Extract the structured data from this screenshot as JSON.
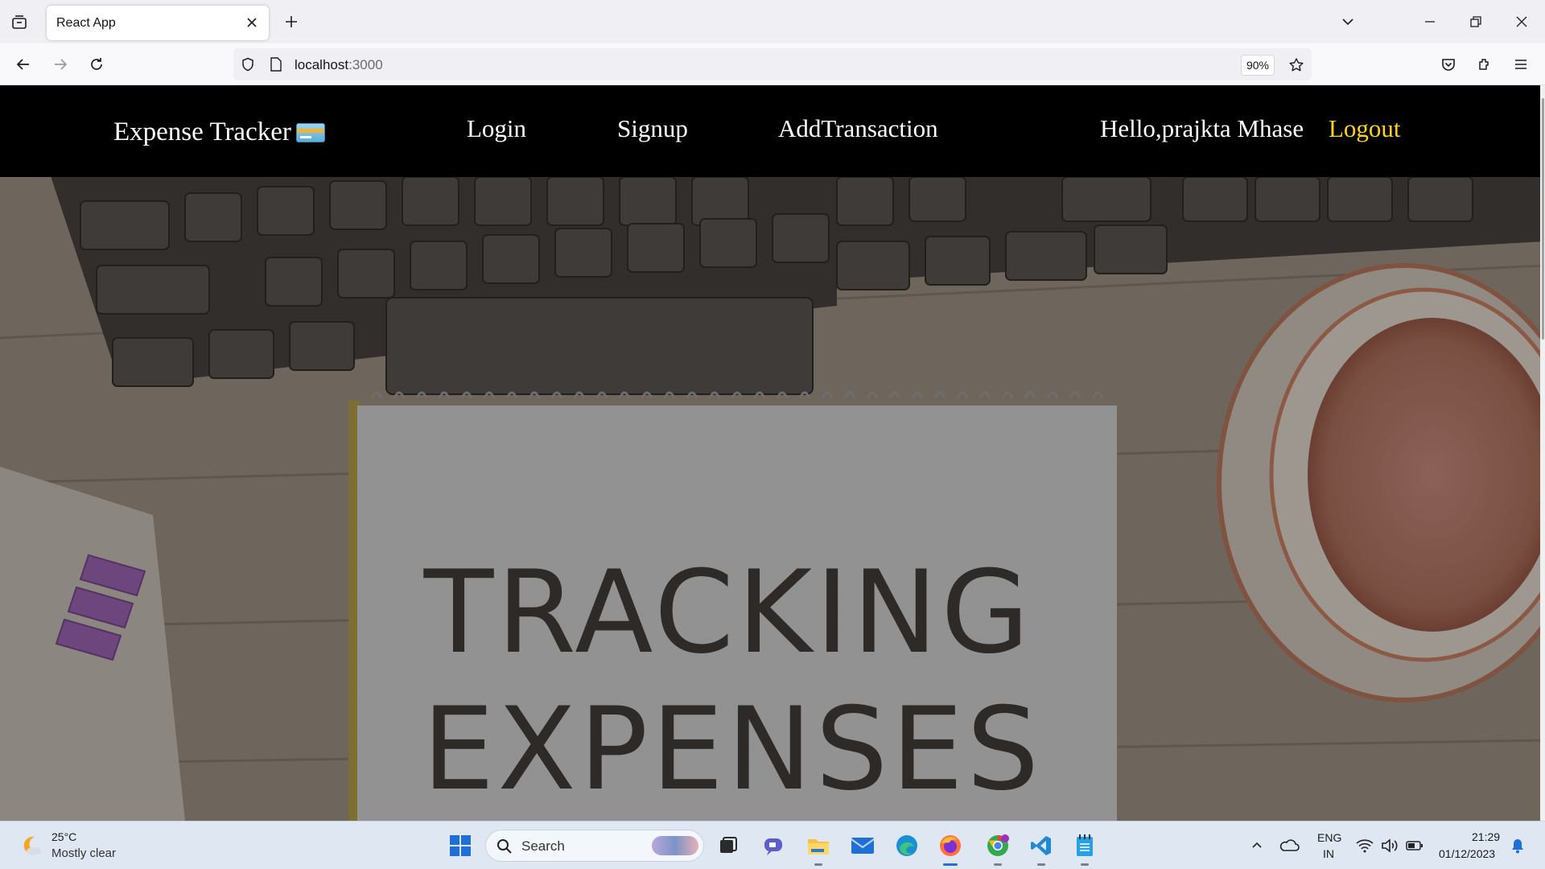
{
  "browser": {
    "tab_title": "React App",
    "url_host": "localhost",
    "url_port": ":3000",
    "zoom": "90%"
  },
  "app": {
    "brand": "Expense Tracker",
    "brand_icon": "credit-card-icon",
    "nav": {
      "login": "Login",
      "signup": "Signup",
      "add_transaction": "AddTransaction",
      "greeting": "Hello,prajkta Mhase",
      "logout": "Logout"
    },
    "hero": {
      "line1": "TRACKING",
      "line2": "EXPENSES"
    },
    "colors": {
      "nav_bg": "#000000",
      "nav_text": "#ffffff",
      "logout_text": "#ffd21f"
    }
  },
  "taskbar": {
    "weather_temp": "25°C",
    "weather_desc": "Mostly clear",
    "search_label": "Search",
    "lang_line1": "ENG",
    "lang_line2": "IN",
    "time": "21:29",
    "date": "01/12/2023"
  }
}
